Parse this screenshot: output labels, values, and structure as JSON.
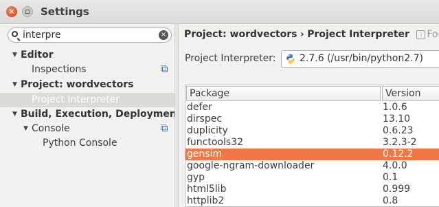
{
  "window": {
    "title": "Settings",
    "close_glyph": "×"
  },
  "search": {
    "value": "interpre",
    "clear_glyph": "×"
  },
  "tree": [
    {
      "label": "Editor",
      "arrow": "▼",
      "bold": true
    },
    {
      "label": "Inspections",
      "bold": false,
      "copy_icon": true
    },
    {
      "label": "Project: wordvectors",
      "arrow": "▼",
      "bold": true
    },
    {
      "label": "Project Interpreter",
      "bold": false,
      "selected": true
    },
    {
      "label": "Build, Execution, Deployment",
      "arrow": "▼",
      "bold": true
    },
    {
      "label": "Console",
      "arrow": "▼",
      "bold": false,
      "copy_icon": true
    },
    {
      "label": "Python Console",
      "bold": false
    }
  ],
  "breadcrumb": {
    "project": "Project: wordvectors",
    "separator": "›",
    "page": "Project Interpreter",
    "hint": "For cu"
  },
  "interpreter": {
    "label": "Project Interpreter:",
    "value": "2.7.6 (/usr/bin/python2.7)",
    "icon": "python-icon"
  },
  "packages": {
    "columns": [
      "Package",
      "Version"
    ],
    "rows": [
      [
        "defer",
        "1.0.6"
      ],
      [
        "dirspec",
        "13.10"
      ],
      [
        "duplicity",
        "0.6.23"
      ],
      [
        "functools32",
        "3.2.3-2"
      ],
      [
        "gensim",
        "0.12.2"
      ],
      [
        "google-ngram-downloader",
        "4.0.0"
      ],
      [
        "gyp",
        "0.1"
      ],
      [
        "html5lib",
        "0.999"
      ],
      [
        "httplib2",
        "0.8"
      ]
    ],
    "selected": "gensim"
  },
  "colors": {
    "selection": "#f07746",
    "accent_close": "#e05a2b"
  }
}
